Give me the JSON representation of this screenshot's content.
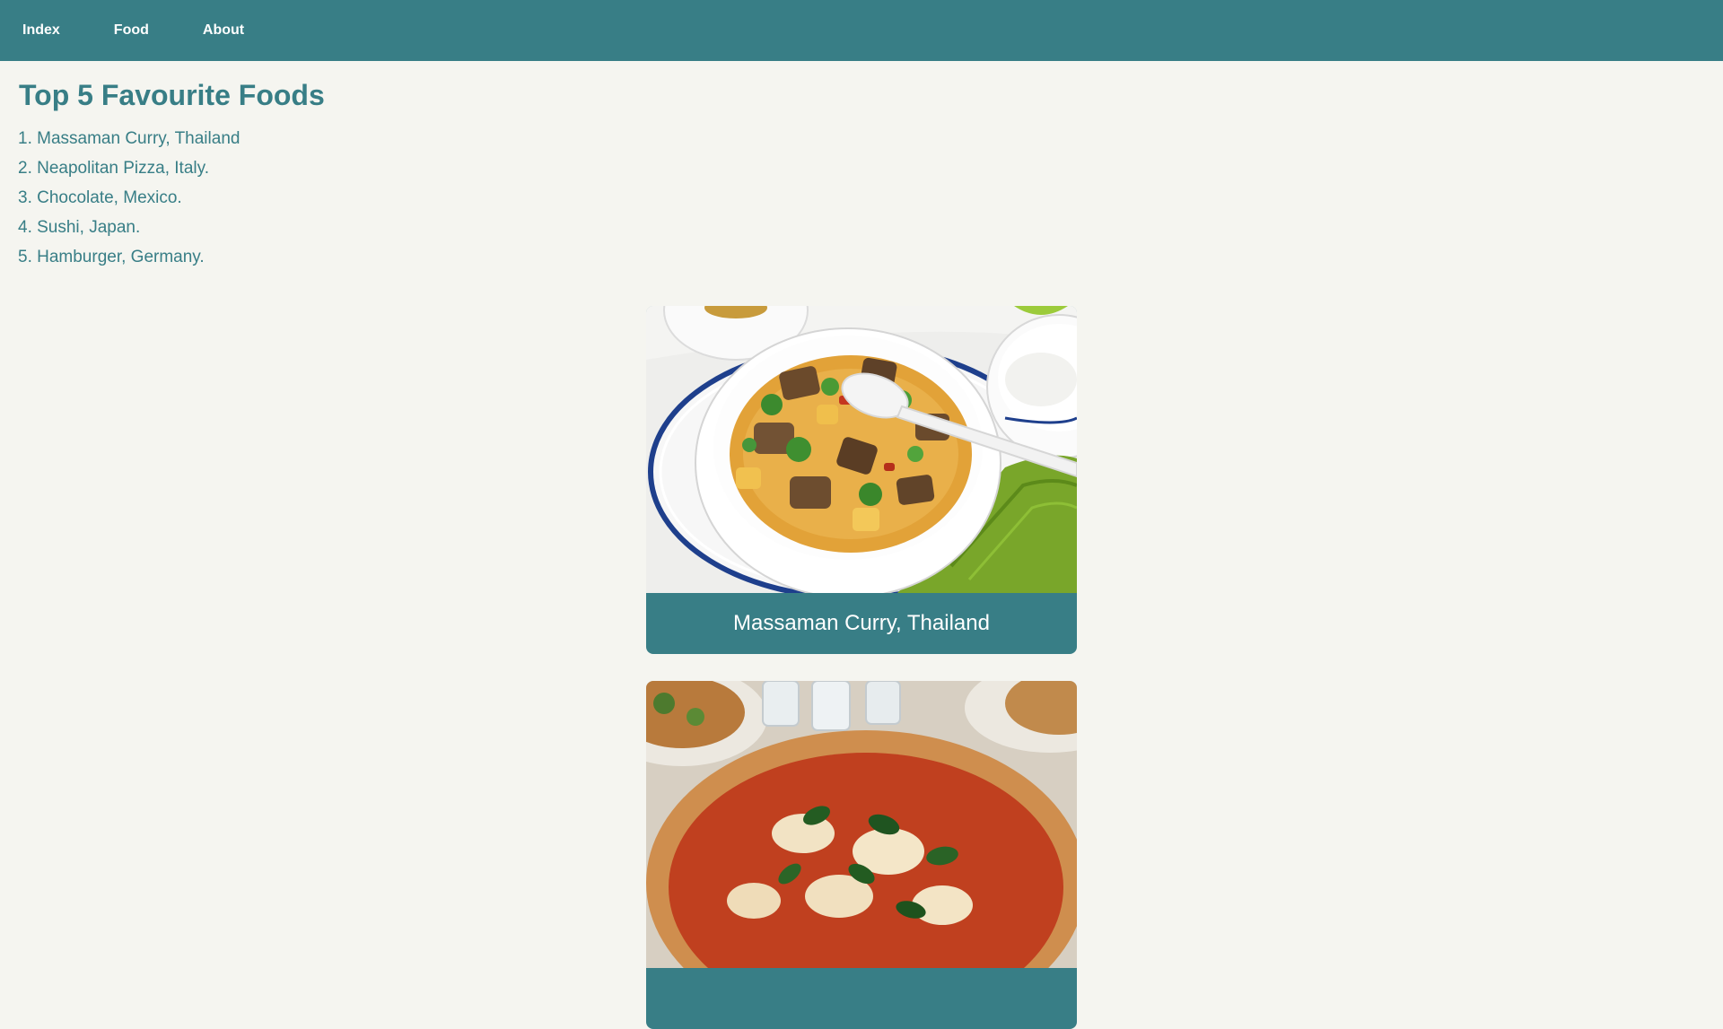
{
  "nav": {
    "links": [
      {
        "label": "Index"
      },
      {
        "label": "Food"
      },
      {
        "label": "About"
      }
    ]
  },
  "main": {
    "title": "Top 5 Favourite Foods",
    "list": [
      "1. Massaman Curry, Thailand",
      "2. Neapolitan Pizza, Italy.",
      "3. Chocolate, Mexico.",
      "4. Sushi, Japan.",
      "5. Hamburger, Germany."
    ]
  },
  "cards": [
    {
      "caption": "Massaman Curry, Thailand",
      "image": "massaman-curry-photo"
    },
    {
      "caption": "",
      "image": "neapolitan-pizza-photo"
    }
  ],
  "colors": {
    "brand": "#387e86",
    "background": "#f5f5f0",
    "text_on_brand": "#ffffff"
  }
}
